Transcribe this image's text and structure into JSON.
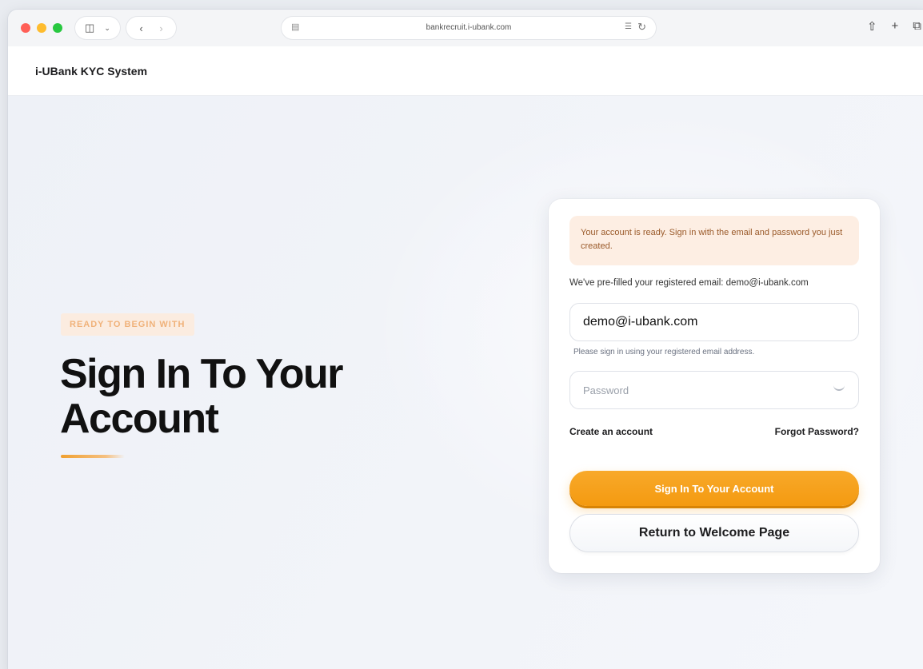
{
  "browser": {
    "url": "bankrecruit.i-ubank.com",
    "icons": {
      "sidebar": "sidebar-icon",
      "chevron": "chevron-down-icon",
      "back": "back-icon",
      "forward": "forward-icon",
      "share": "share-icon",
      "new_tab": "plus-icon",
      "tabs": "tabs-icon",
      "reload": "reload-icon",
      "translate": "translate-icon"
    }
  },
  "header": {
    "brand": "i-UBank KYC System"
  },
  "hero": {
    "eyebrow": "READY TO BEGIN WITH",
    "headline": "Sign In To Your Account",
    "accent_color": "#f49a10"
  },
  "login": {
    "notice": "Your account is ready. Sign in with the email and password you just created.",
    "prefill_text": "We've pre-filled your registered email: demo@i-ubank.com",
    "email_value": "demo@i-ubank.com",
    "email_helper": "Please sign in using your registered email address.",
    "password_placeholder": "Password",
    "create_account": "Create an account",
    "forgot_password": "Forgot Password?",
    "submit_label": "Sign In To Your Account",
    "return_label": "Return to Welcome Page"
  }
}
